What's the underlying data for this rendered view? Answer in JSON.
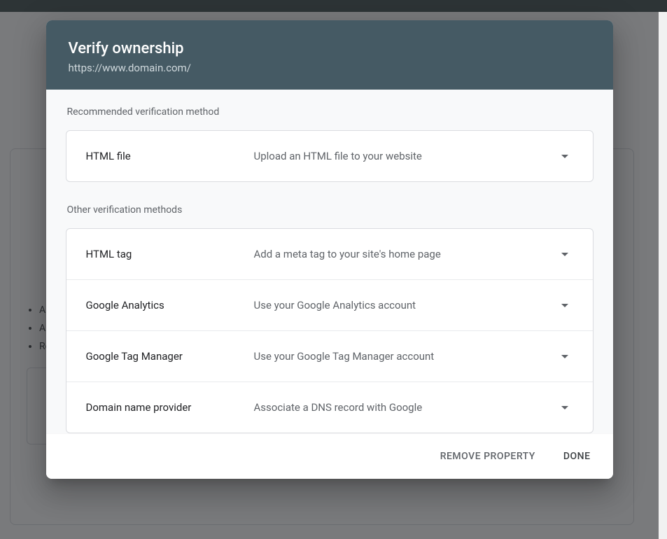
{
  "modal": {
    "title": "Verify ownership",
    "subtitle": "https://www.domain.com/",
    "recommended_label": "Recommended verification method",
    "other_label": "Other verification methods",
    "recommended": {
      "name": "HTML file",
      "desc": "Upload an HTML file to your website"
    },
    "other_methods": [
      {
        "name": "HTML tag",
        "desc": "Add a meta tag to your site's home page"
      },
      {
        "name": "Google Analytics",
        "desc": "Use your Google Analytics account"
      },
      {
        "name": "Google Tag Manager",
        "desc": "Use your Google Tag Manager account"
      },
      {
        "name": "Domain name provider",
        "desc": "Associate a DNS record with Google"
      }
    ],
    "footer": {
      "remove": "REMOVE PROPERTY",
      "done": "DONE"
    }
  },
  "background": {
    "list_items": [
      "All",
      "All",
      "Re"
    ]
  }
}
